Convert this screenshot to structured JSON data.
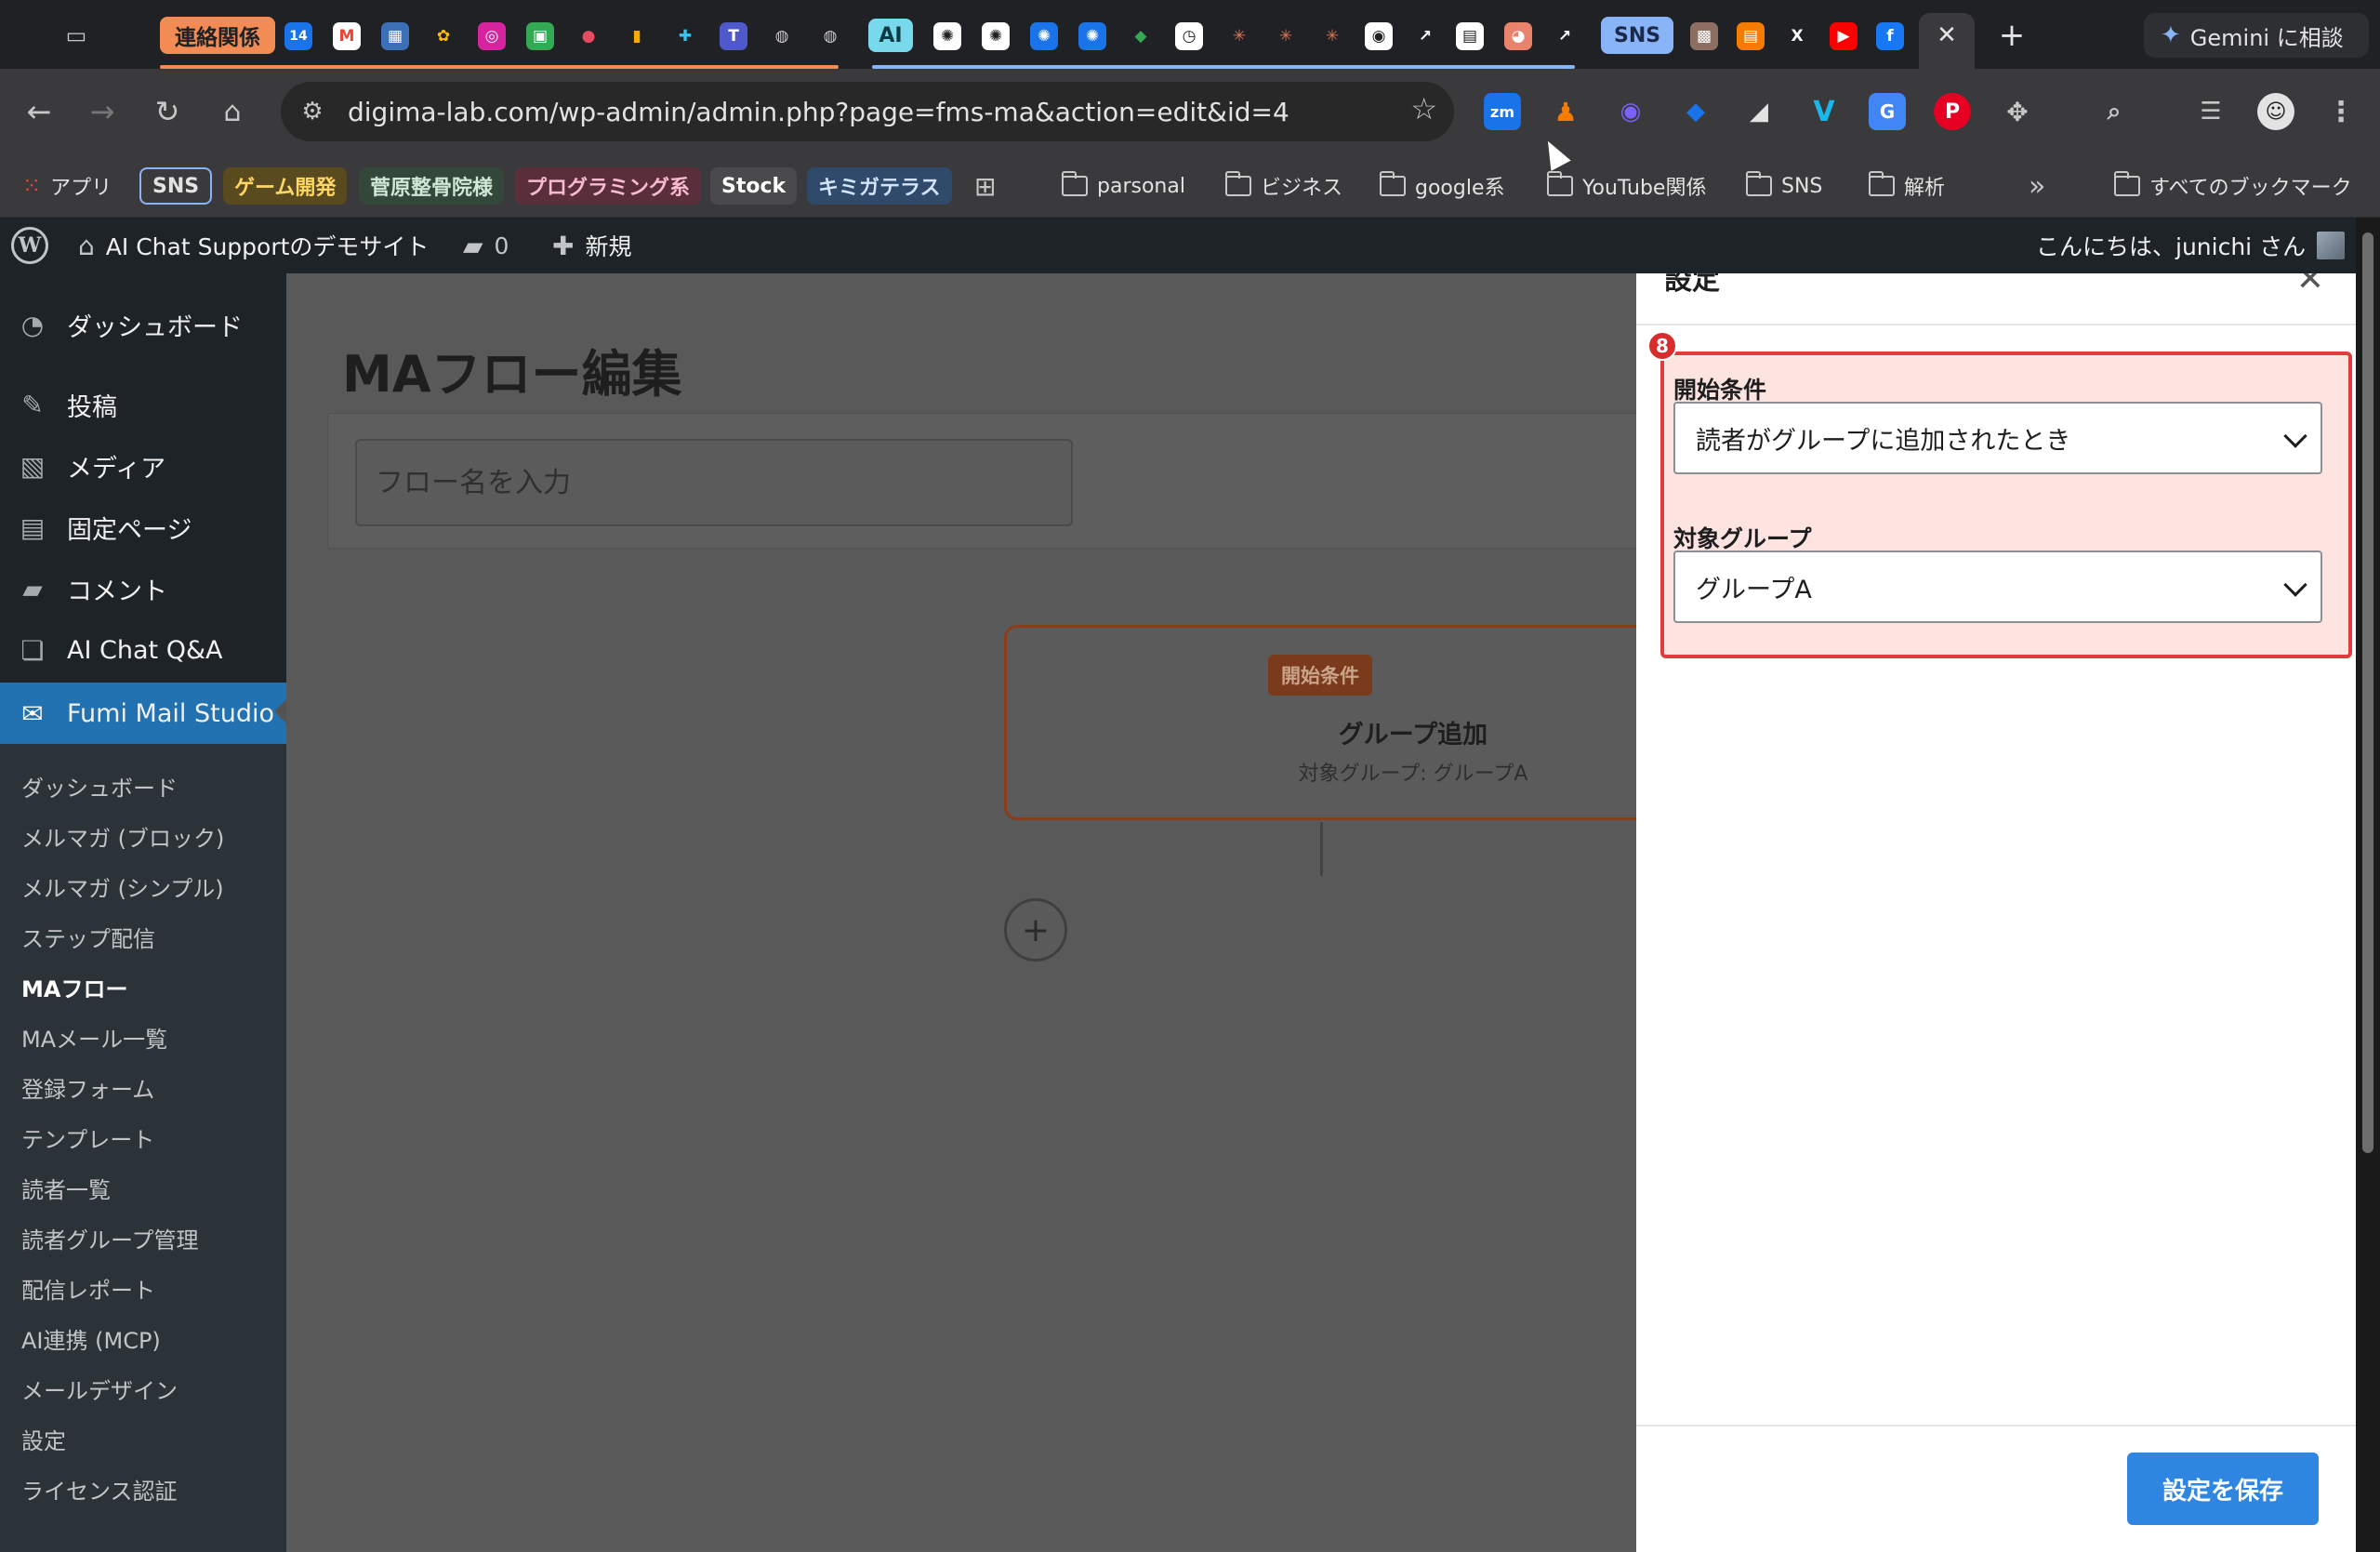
{
  "browser": {
    "tab_group_label": "連絡関係",
    "ai_chip": "AI",
    "sns_chip": "SNS",
    "gemini_label": "Gemini に相談",
    "url": "digima-lab.com/wp-admin/admin.php?page=fms-ma&action=edit&id=4",
    "calendar_badge": "14",
    "ext_zoom": "zm",
    "bookmarks": {
      "apps": "アプリ",
      "sns": "SNS",
      "game_dev": "ゲーム開発",
      "sugawara": "菅原整骨院様",
      "programming": "プログラミング系",
      "stock": "Stock",
      "kimigaterasu": "キミガテラス",
      "parsonal": "parsonal",
      "business": "ビジネス",
      "google": "google系",
      "youtube": "YouTube関係",
      "sns_folder": "SNS",
      "analysis": "解析",
      "more": "»",
      "all_bookmarks": "すべてのブックマーク"
    }
  },
  "adminbar": {
    "site_name": "AI Chat Supportのデモサイト",
    "comments_count": "0",
    "new_label": "新規",
    "greeting": "こんにちは、junichi さん"
  },
  "sidebar": {
    "dashboard": "ダッシュボード",
    "posts": "投稿",
    "media": "メディア",
    "pages": "固定ページ",
    "comments": "コメント",
    "ai_chat": "AI Chat Q&A",
    "fumi": "Fumi Mail Studio",
    "submenu": [
      "ダッシュボード",
      "メルマガ (ブロック)",
      "メルマガ (シンプル)",
      "ステップ配信",
      "MAフロー",
      "MAメール一覧",
      "登録フォーム",
      "テンプレート",
      "読者一覧",
      "読者グループ管理",
      "配信レポート",
      "AI連携 (MCP)",
      "メールデザイン",
      "設定",
      "ライセンス認証"
    ]
  },
  "content": {
    "heading": "MAフロー編集",
    "flow_name_placeholder": "フロー名を入力",
    "trigger_badge": "開始条件",
    "trigger_title": "グループ追加",
    "trigger_subtitle": "対象グループ: グループA",
    "add_symbol": "+"
  },
  "panel": {
    "title": "設定",
    "close": "✕",
    "highlight_number": "8",
    "start_condition_label": "開始条件",
    "start_condition_value": "読者がグループに追加されたとき",
    "target_group_label": "対象グループ",
    "target_group_value": "グループA",
    "save_button": "設定を保存"
  },
  "colors": {
    "wp_admin_dark": "#1d2327",
    "wp_active_blue": "#2271b1",
    "save_button": "#2e86e0",
    "highlight_red": "#e23b3b",
    "trigger_orange": "#c4571f"
  }
}
